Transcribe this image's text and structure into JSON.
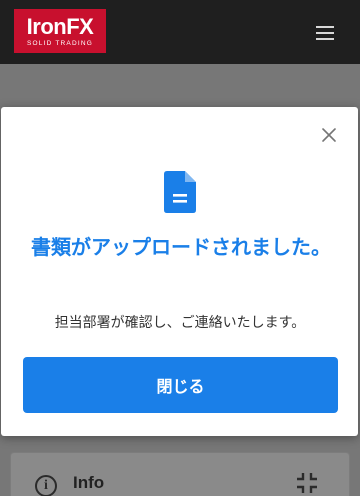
{
  "header": {
    "logo_text": "IronFX",
    "logo_tagline": "SOLID TRADING",
    "brand_color": "#c8102e",
    "menu_icon": "hamburger-menu-icon"
  },
  "background_card": {
    "info_icon": "info-icon",
    "info_label": "Info",
    "collapse_icon": "collapse-icon"
  },
  "modal": {
    "close_icon": "close-icon",
    "doc_icon": "document-icon",
    "title": "書類がアップロードされました。",
    "message": "担当部署が確認し、ご連絡いたします。",
    "button_label": "閉じる",
    "accent_color": "#1a7fe8"
  }
}
